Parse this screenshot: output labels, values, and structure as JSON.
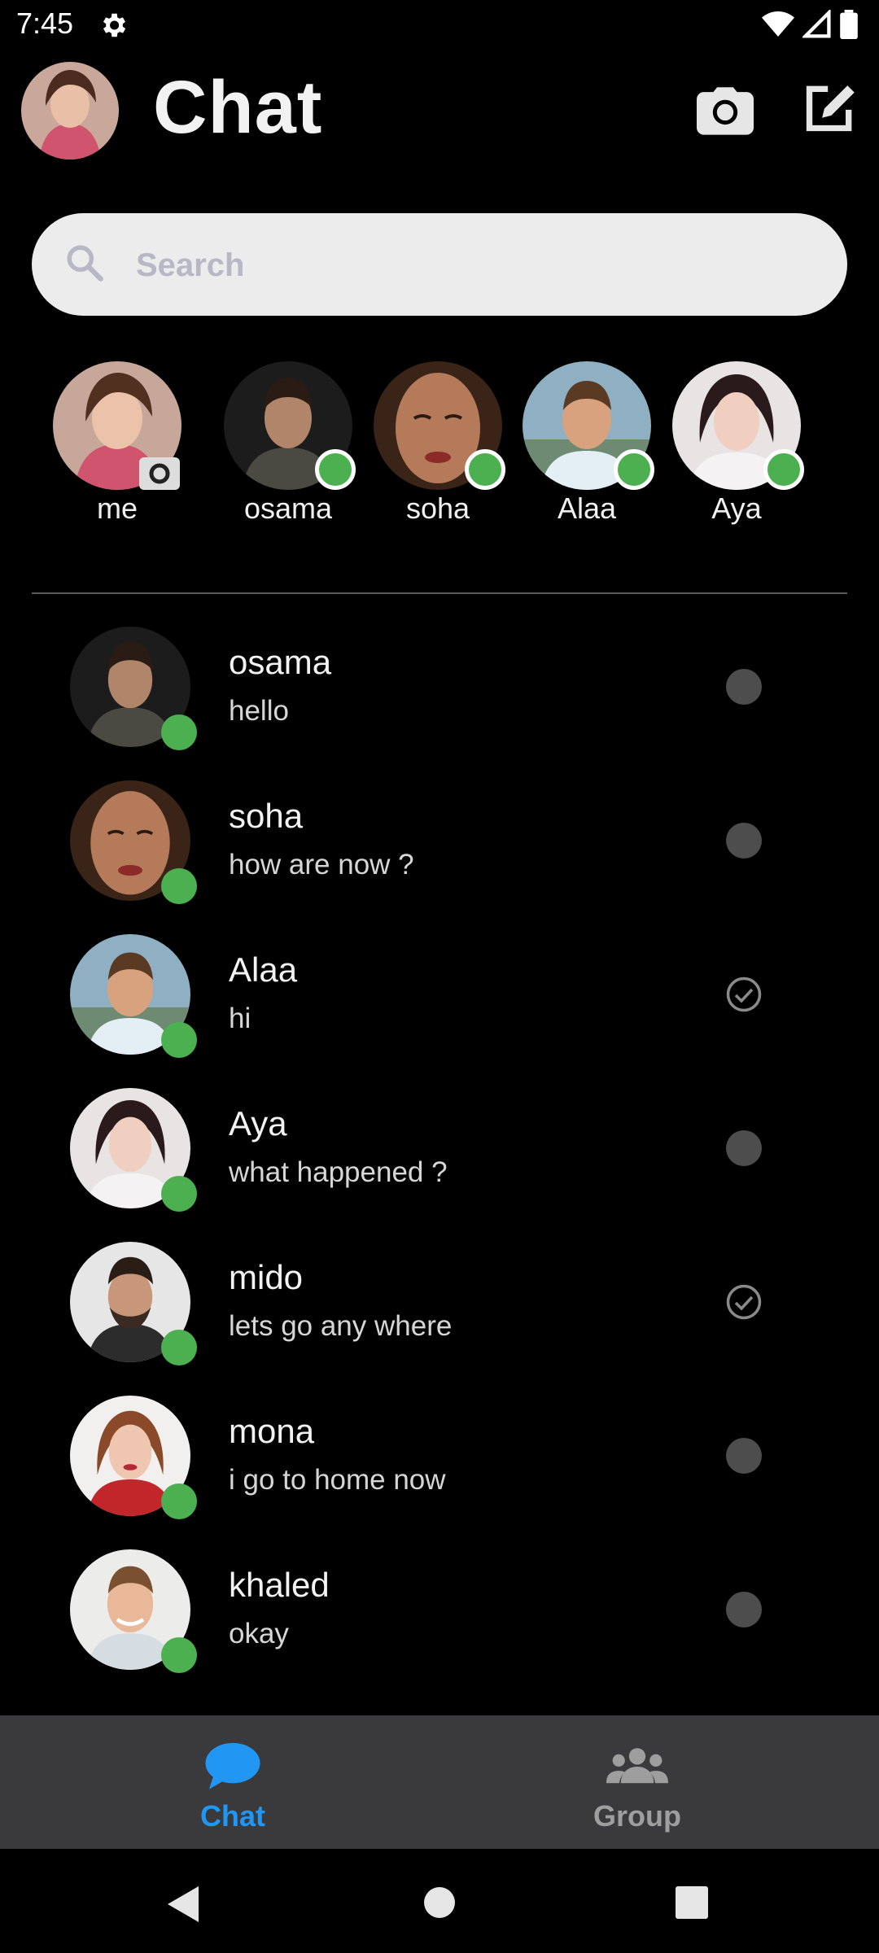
{
  "status_bar": {
    "time": "7:45"
  },
  "header": {
    "title": "Chat"
  },
  "search": {
    "placeholder": "Search"
  },
  "stories": [
    {
      "name": "me"
    },
    {
      "name": "osama"
    },
    {
      "name": "soha"
    },
    {
      "name": "Alaa"
    },
    {
      "name": "Aya"
    }
  ],
  "chats": [
    {
      "name": "osama",
      "message": "hello",
      "status": "unread"
    },
    {
      "name": "soha",
      "message": "how are now ?",
      "status": "unread"
    },
    {
      "name": "Alaa",
      "message": "hi",
      "status": "read"
    },
    {
      "name": "Aya",
      "message": "what happened ?",
      "status": "unread"
    },
    {
      "name": "mido",
      "message": "lets go any where",
      "status": "read"
    },
    {
      "name": "mona",
      "message": "i go to  home now",
      "status": "unread"
    },
    {
      "name": "khaled",
      "message": "okay",
      "status": "unread"
    }
  ],
  "bottom_nav": {
    "chat_label": "Chat",
    "group_label": "Group",
    "active": "chat"
  },
  "colors": {
    "online": "#4caf50",
    "active_tab": "#2196f3",
    "inactive_tab": "#9e9e9e"
  }
}
